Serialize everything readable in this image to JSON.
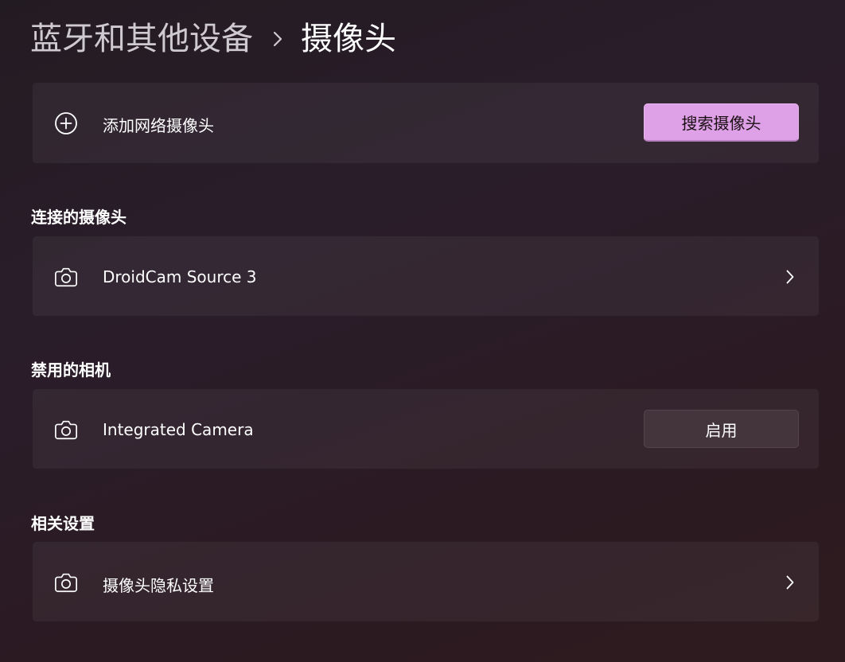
{
  "breadcrumb": {
    "parent": "蓝牙和其他设备",
    "current": "摄像头"
  },
  "add_network_camera": {
    "label": "添加网络摄像头",
    "button_label": "搜索摄像头",
    "icon": "add-circle-icon"
  },
  "connected_cameras": {
    "title": "连接的摄像头",
    "items": [
      {
        "label": "DroidCam Source 3",
        "icon": "camera-icon"
      }
    ]
  },
  "disabled_cameras": {
    "title": "禁用的相机",
    "items": [
      {
        "label": "Integrated Camera",
        "button_label": "启用",
        "icon": "camera-icon"
      }
    ]
  },
  "related_settings": {
    "title": "相关设置",
    "items": [
      {
        "label": "摄像头隐私设置",
        "icon": "camera-icon"
      }
    ]
  },
  "colors": {
    "accent": "#dea0e6",
    "background": "#2a1d27"
  }
}
